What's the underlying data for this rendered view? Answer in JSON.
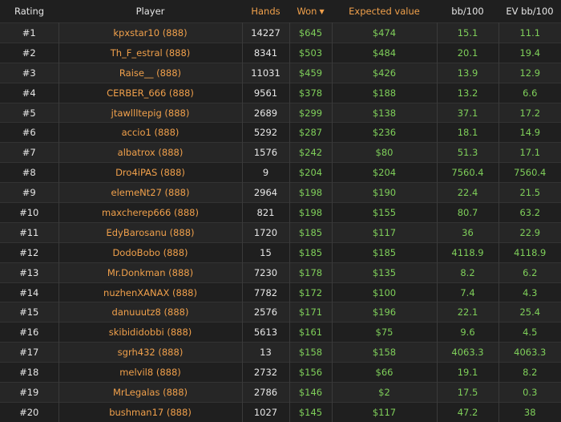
{
  "headers": {
    "rating": "Rating",
    "player": "Player",
    "hands": "Hands",
    "won": "Won",
    "ev": "Expected value",
    "bb100": "bb/100",
    "evbb100": "EV bb/100"
  },
  "sort_indicator_icon": "caret-down-icon",
  "colors": {
    "background": "#1f1f1f",
    "accent": "#f0a04b",
    "positive": "#7fcf5a",
    "text": "#e6e6e6"
  },
  "rows": [
    {
      "rank": "#1",
      "player": "kpxstar10 (888)",
      "hands": "14227",
      "won": "$645",
      "ev": "$474",
      "bb": "15.1",
      "evbb": "11.1"
    },
    {
      "rank": "#2",
      "player": "Th_F_estral (888)",
      "hands": "8341",
      "won": "$503",
      "ev": "$484",
      "bb": "20.1",
      "evbb": "19.4"
    },
    {
      "rank": "#3",
      "player": "Raise__ (888)",
      "hands": "11031",
      "won": "$459",
      "ev": "$426",
      "bb": "13.9",
      "evbb": "12.9"
    },
    {
      "rank": "#4",
      "player": "CERBER_666 (888)",
      "hands": "9561",
      "won": "$378",
      "ev": "$188",
      "bb": "13.2",
      "evbb": "6.6"
    },
    {
      "rank": "#5",
      "player": "jtawllltepig (888)",
      "hands": "2689",
      "won": "$299",
      "ev": "$138",
      "bb": "37.1",
      "evbb": "17.2"
    },
    {
      "rank": "#6",
      "player": "accio1 (888)",
      "hands": "5292",
      "won": "$287",
      "ev": "$236",
      "bb": "18.1",
      "evbb": "14.9"
    },
    {
      "rank": "#7",
      "player": "albatrox (888)",
      "hands": "1576",
      "won": "$242",
      "ev": "$80",
      "bb": "51.3",
      "evbb": "17.1"
    },
    {
      "rank": "#8",
      "player": "Dro4iPAS (888)",
      "hands": "9",
      "won": "$204",
      "ev": "$204",
      "bb": "7560.4",
      "evbb": "7560.4"
    },
    {
      "rank": "#9",
      "player": "elemeNt27 (888)",
      "hands": "2964",
      "won": "$198",
      "ev": "$190",
      "bb": "22.4",
      "evbb": "21.5"
    },
    {
      "rank": "#10",
      "player": "maxcherep666 (888)",
      "hands": "821",
      "won": "$198",
      "ev": "$155",
      "bb": "80.7",
      "evbb": "63.2"
    },
    {
      "rank": "#11",
      "player": "EdyBarosanu (888)",
      "hands": "1720",
      "won": "$185",
      "ev": "$117",
      "bb": "36",
      "evbb": "22.9"
    },
    {
      "rank": "#12",
      "player": "DodoBobo (888)",
      "hands": "15",
      "won": "$185",
      "ev": "$185",
      "bb": "4118.9",
      "evbb": "4118.9"
    },
    {
      "rank": "#13",
      "player": "Mr.Donkman (888)",
      "hands": "7230",
      "won": "$178",
      "ev": "$135",
      "bb": "8.2",
      "evbb": "6.2"
    },
    {
      "rank": "#14",
      "player": "nuzhenXANAX (888)",
      "hands": "7782",
      "won": "$172",
      "ev": "$100",
      "bb": "7.4",
      "evbb": "4.3"
    },
    {
      "rank": "#15",
      "player": "danuuutz8 (888)",
      "hands": "2576",
      "won": "$171",
      "ev": "$196",
      "bb": "22.1",
      "evbb": "25.4"
    },
    {
      "rank": "#16",
      "player": "skibididobbi (888)",
      "hands": "5613",
      "won": "$161",
      "ev": "$75",
      "bb": "9.6",
      "evbb": "4.5"
    },
    {
      "rank": "#17",
      "player": "sgrh432 (888)",
      "hands": "13",
      "won": "$158",
      "ev": "$158",
      "bb": "4063.3",
      "evbb": "4063.3"
    },
    {
      "rank": "#18",
      "player": "melvil8 (888)",
      "hands": "2732",
      "won": "$156",
      "ev": "$66",
      "bb": "19.1",
      "evbb": "8.2"
    },
    {
      "rank": "#19",
      "player": "MrLegalas (888)",
      "hands": "2786",
      "won": "$146",
      "ev": "$2",
      "bb": "17.5",
      "evbb": "0.3"
    },
    {
      "rank": "#20",
      "player": "bushman17 (888)",
      "hands": "1027",
      "won": "$145",
      "ev": "$117",
      "bb": "47.2",
      "evbb": "38"
    }
  ]
}
